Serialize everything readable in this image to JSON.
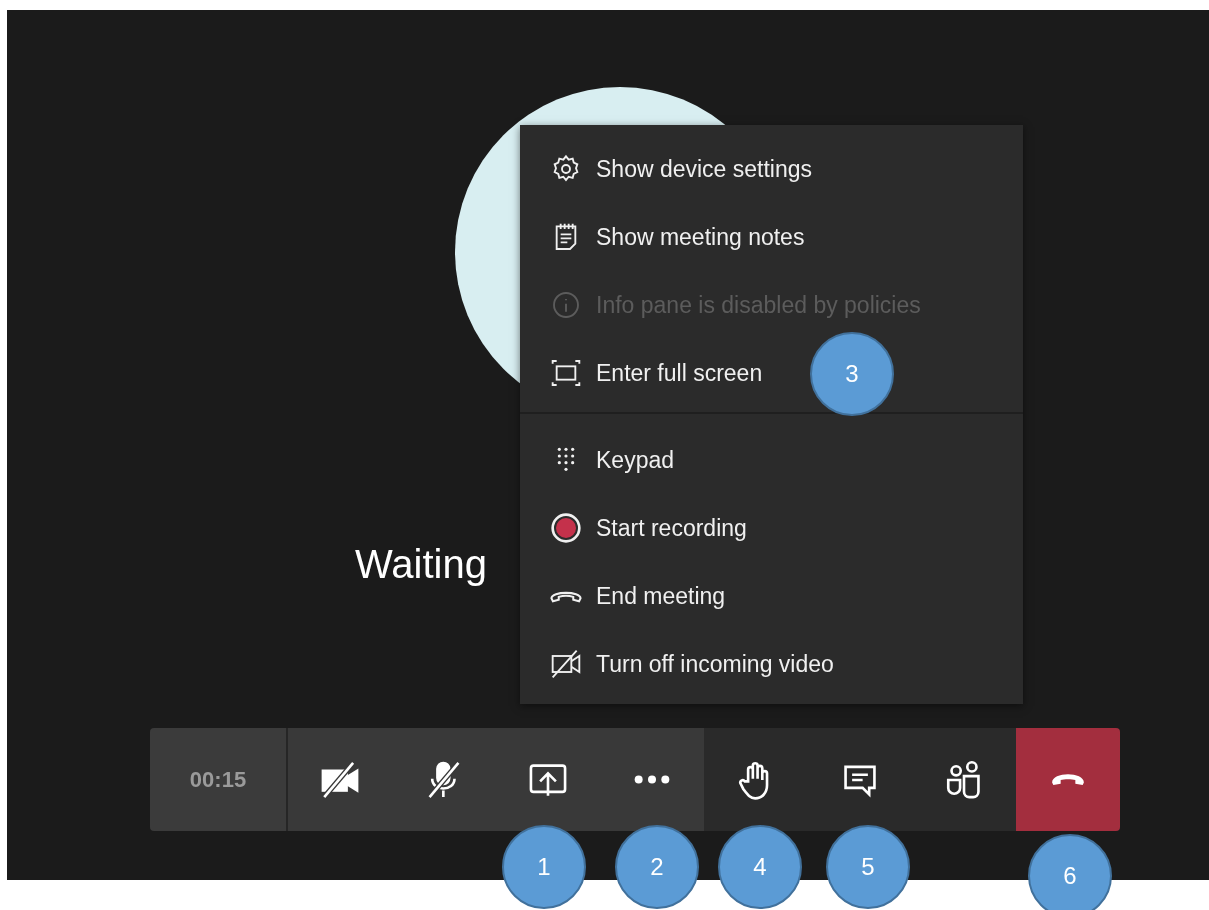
{
  "stage": {
    "status_text": "Waiting"
  },
  "menu": {
    "sections": [
      {
        "items": [
          {
            "label": "Show device settings",
            "kind": "gear",
            "disabled": false
          },
          {
            "label": "Show meeting notes",
            "kind": "notes",
            "disabled": false
          },
          {
            "label": "Info pane is disabled by policies",
            "kind": "info",
            "disabled": true
          },
          {
            "label": "Enter full screen",
            "kind": "fullscreen",
            "disabled": false
          }
        ]
      },
      {
        "items": [
          {
            "label": "Keypad",
            "kind": "keypad",
            "disabled": false
          },
          {
            "label": "Start recording",
            "kind": "record",
            "disabled": false
          },
          {
            "label": "End meeting",
            "kind": "hangup",
            "disabled": false
          },
          {
            "label": "Turn off incoming video",
            "kind": "video-off",
            "disabled": false
          }
        ]
      }
    ]
  },
  "toolbar": {
    "timer": "00:15",
    "sections": [
      {
        "buttons": [
          {
            "kind": "camera-off"
          },
          {
            "kind": "mic-off"
          },
          {
            "kind": "share"
          },
          {
            "kind": "more"
          }
        ]
      },
      {
        "buttons": [
          {
            "kind": "hand"
          },
          {
            "kind": "chat"
          },
          {
            "kind": "people"
          }
        ]
      },
      {
        "buttons": [
          {
            "kind": "hangup"
          }
        ]
      }
    ]
  },
  "callouts": [
    {
      "label": "1"
    },
    {
      "label": "2"
    },
    {
      "label": "3"
    },
    {
      "label": "4"
    },
    {
      "label": "5"
    },
    {
      "label": "6"
    }
  ]
}
